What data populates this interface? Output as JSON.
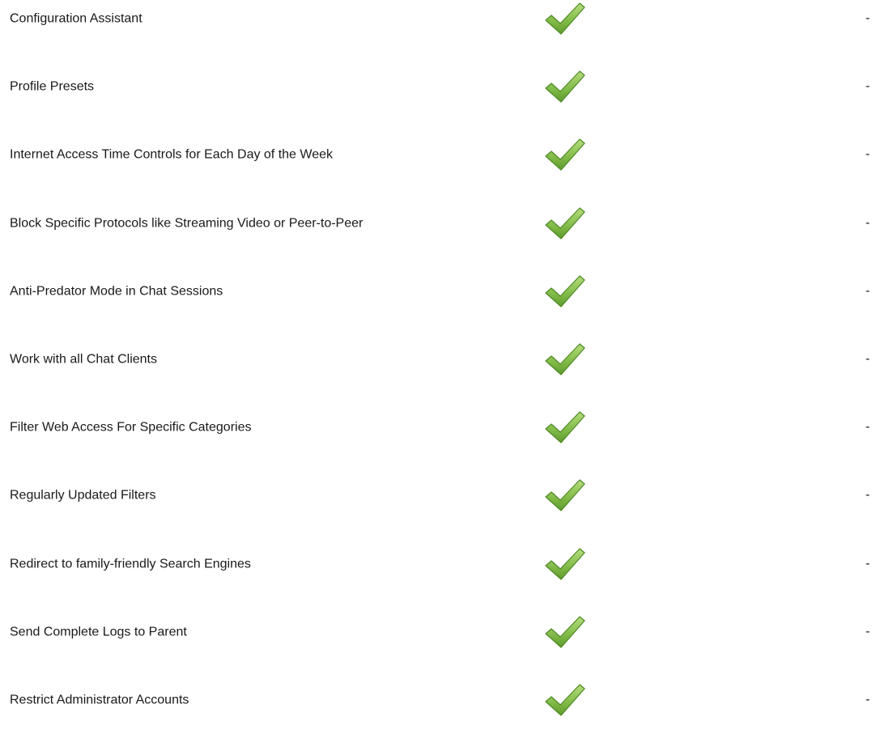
{
  "features": {
    "rows": [
      {
        "label": "Configuration Assistant",
        "check": "checkmark-icon",
        "extra": "-"
      },
      {
        "label": "Profile Presets",
        "check": "checkmark-icon",
        "extra": "-"
      },
      {
        "label": "Internet Access Time Controls for Each Day of the Week",
        "check": "checkmark-icon",
        "extra": "-"
      },
      {
        "label": "Block Specific Protocols like Streaming Video or Peer-to-Peer",
        "check": "checkmark-icon",
        "extra": "-"
      },
      {
        "label": "Anti-Predator Mode in Chat Sessions",
        "check": "checkmark-icon",
        "extra": "-"
      },
      {
        "label": "Work with all Chat Clients",
        "check": "checkmark-icon",
        "extra": "-"
      },
      {
        "label": "Filter Web Access For Specific Categories",
        "check": "checkmark-icon",
        "extra": "-"
      },
      {
        "label": "Regularly Updated Filters",
        "check": "checkmark-icon",
        "extra": "-"
      },
      {
        "label": "Redirect to family-friendly Search Engines",
        "check": "checkmark-icon",
        "extra": "-"
      },
      {
        "label": "Send Complete Logs to Parent",
        "check": "checkmark-icon",
        "extra": "-"
      },
      {
        "label": "Restrict Administrator Accounts",
        "check": "checkmark-icon",
        "extra": "-"
      }
    ]
  },
  "colors": {
    "check_light": "#a6d36b",
    "check_dark": "#5e9a2c",
    "check_edge": "#4f8a25"
  }
}
